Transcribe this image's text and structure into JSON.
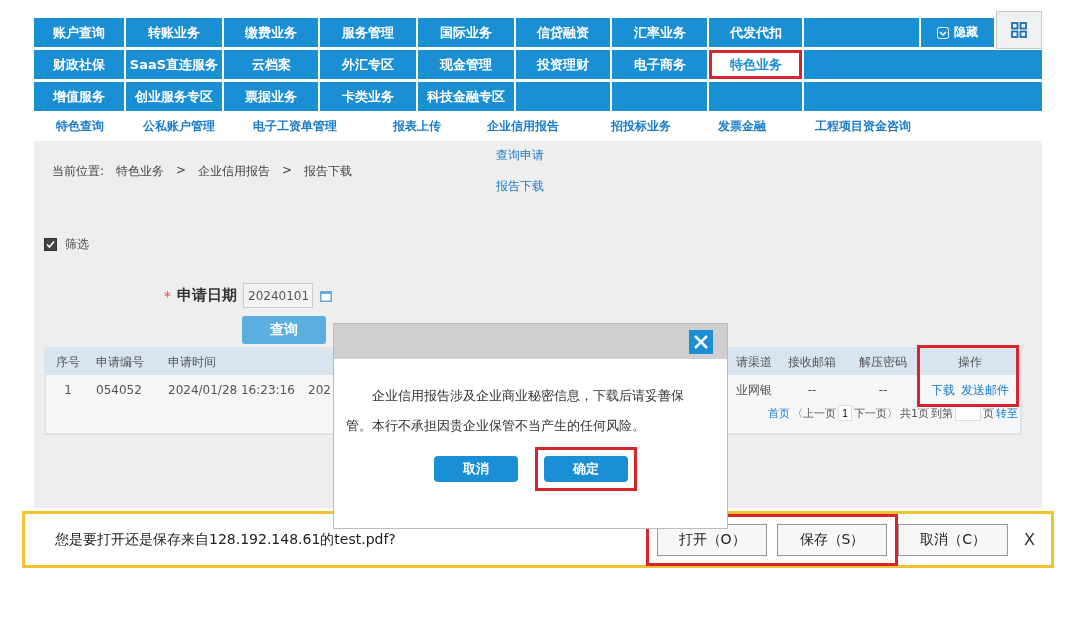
{
  "nav": {
    "rows": [
      [
        {
          "label": "账户查询",
          "selected": false,
          "highlighted": false
        },
        {
          "label": "转账业务",
          "selected": false,
          "highlighted": false
        },
        {
          "label": "缴费业务",
          "selected": false,
          "highlighted": false
        },
        {
          "label": "服务管理",
          "selected": false,
          "highlighted": false
        },
        {
          "label": "国际业务",
          "selected": false,
          "highlighted": false
        },
        {
          "label": "信贷融资",
          "selected": false,
          "highlighted": false
        },
        {
          "label": "汇率业务",
          "selected": false,
          "highlighted": false
        },
        {
          "label": "代发代扣",
          "selected": false,
          "highlighted": false
        }
      ],
      [
        {
          "label": "财政社保",
          "selected": false,
          "highlighted": false
        },
        {
          "label": "SaaS直连服务",
          "selected": false,
          "highlighted": false
        },
        {
          "label": "云档案",
          "selected": false,
          "highlighted": false
        },
        {
          "label": "外汇专区",
          "selected": false,
          "highlighted": false
        },
        {
          "label": "现金管理",
          "selected": false,
          "highlighted": false
        },
        {
          "label": "投资理财",
          "selected": false,
          "highlighted": false
        },
        {
          "label": "电子商务",
          "selected": false,
          "highlighted": false
        },
        {
          "label": "特色业务",
          "selected": true,
          "highlighted": true
        }
      ],
      [
        {
          "label": "增值服务",
          "selected": false,
          "highlighted": false
        },
        {
          "label": "创业服务专区",
          "selected": false,
          "highlighted": false
        },
        {
          "label": "票据业务",
          "selected": false,
          "highlighted": false
        },
        {
          "label": "卡类业务",
          "selected": false,
          "highlighted": false
        },
        {
          "label": "科技金融专区",
          "selected": false,
          "highlighted": false
        }
      ]
    ],
    "hide_button": "隐藏"
  },
  "subnav": [
    "特色查询",
    "公私账户管理",
    "电子工资单管理",
    "报表上传",
    "企业信用报告",
    "招投标业务",
    "发票金融",
    "工程项目资金咨询"
  ],
  "dropdown": [
    "查询申请",
    "报告下载"
  ],
  "breadcrumb": {
    "label": "当前位置:",
    "items": [
      "特色业务",
      ">",
      "企业信用报告",
      ">",
      "报告下载"
    ]
  },
  "filter": {
    "label": "筛选",
    "checked": true
  },
  "form": {
    "required_mark": "*",
    "label": "申请日期",
    "value": "20240101",
    "button": "查询"
  },
  "table": {
    "columns": [
      "序号",
      "申请编号",
      "申请时间",
      "",
      "请渠道",
      "接收邮箱",
      "解压密码",
      "操作"
    ],
    "actions_highlighted": true,
    "rows": [
      {
        "cells": [
          "1",
          "054052",
          "2024/01/28  16:23:16",
          "202",
          "业网银",
          "--",
          "--"
        ],
        "actions": [
          "下载",
          "发送邮件"
        ]
      }
    ]
  },
  "pagination": {
    "first": "首页",
    "prev": "〈上一页",
    "page": "1",
    "next": "下一页〉",
    "total": "共1页",
    "goto": "到第",
    "unit": "页",
    "go": "转至"
  },
  "dialog": {
    "text": "企业信用报告涉及企业商业秘密信息，下载后请妥善保管。本行不承担因贵企业保管不当产生的任何风险。",
    "buttons": [
      {
        "label": "取消",
        "highlighted": false
      },
      {
        "label": "确定",
        "highlighted": true
      }
    ]
  },
  "download_bar": {
    "message": "您是要打开还是保存来自128.192.148.61的test.pdf?",
    "buttons": [
      {
        "label": "打开（O）",
        "highlighted": true
      },
      {
        "label": "保存（S）",
        "highlighted": true
      },
      {
        "label": "取消（C）",
        "highlighted": false
      }
    ],
    "close": "X"
  }
}
